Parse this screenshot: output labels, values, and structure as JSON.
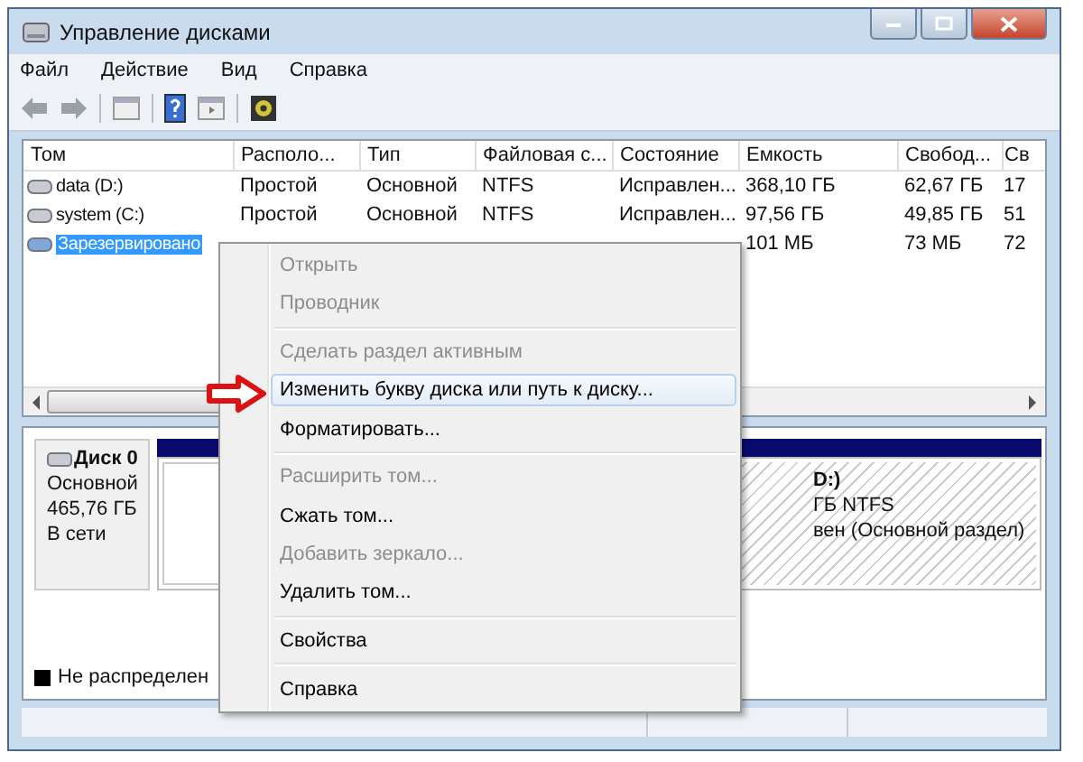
{
  "window": {
    "title": "Управление дисками"
  },
  "menu": [
    "Файл",
    "Действие",
    "Вид",
    "Справка"
  ],
  "table": {
    "columns": [
      "Том",
      "Располо...",
      "Тип",
      "Файловая с...",
      "Состояние",
      "Емкость",
      "Свобод...",
      "Св"
    ],
    "rows": [
      {
        "selected": false,
        "cells": [
          "data (D:)",
          "Простой",
          "Основной",
          "NTFS",
          "Исправлен...",
          "368,10 ГБ",
          "62,67 ГБ",
          "17"
        ]
      },
      {
        "selected": false,
        "cells": [
          "system (C:)",
          "Простой",
          "Основной",
          "NTFS",
          "Исправлен...",
          "97,56 ГБ",
          "49,85 ГБ",
          "51"
        ]
      },
      {
        "selected": true,
        "cells": [
          "Зарезервировано",
          null,
          null,
          null,
          null,
          "101 МБ",
          "73 МБ",
          "72"
        ]
      }
    ]
  },
  "disk": {
    "name": "Диск 0",
    "type": "Основной",
    "size": "465,76 ГБ",
    "status": "В сети",
    "partition": {
      "selected": true,
      "lines": [
        "D:)",
        "ГБ NTFS",
        "вен (Основной раздел)"
      ]
    }
  },
  "legend": [
    {
      "label": "Не распределен",
      "color": "#000000"
    }
  ],
  "context_menu": [
    {
      "kind": "item",
      "label": "Открыть",
      "disabled": true,
      "selected": false
    },
    {
      "kind": "item",
      "label": "Проводник",
      "disabled": true,
      "selected": false
    },
    {
      "kind": "separator"
    },
    {
      "kind": "item",
      "label": "Сделать раздел активным",
      "disabled": true,
      "selected": false
    },
    {
      "kind": "item",
      "label": "Изменить букву диска или путь к диску...",
      "disabled": false,
      "selected": true
    },
    {
      "kind": "item",
      "label": "Форматировать...",
      "disabled": false,
      "selected": false
    },
    {
      "kind": "separator"
    },
    {
      "kind": "item",
      "label": "Расширить том...",
      "disabled": true,
      "selected": false
    },
    {
      "kind": "item",
      "label": "Сжать том...",
      "disabled": false,
      "selected": false
    },
    {
      "kind": "item",
      "label": "Добавить зеркало...",
      "disabled": true,
      "selected": false
    },
    {
      "kind": "item",
      "label": "Удалить том...",
      "disabled": false,
      "selected": false
    },
    {
      "kind": "separator"
    },
    {
      "kind": "item",
      "label": "Свойства",
      "disabled": false,
      "selected": false
    },
    {
      "kind": "separator"
    },
    {
      "kind": "item",
      "label": "Справка",
      "disabled": false,
      "selected": false
    }
  ]
}
